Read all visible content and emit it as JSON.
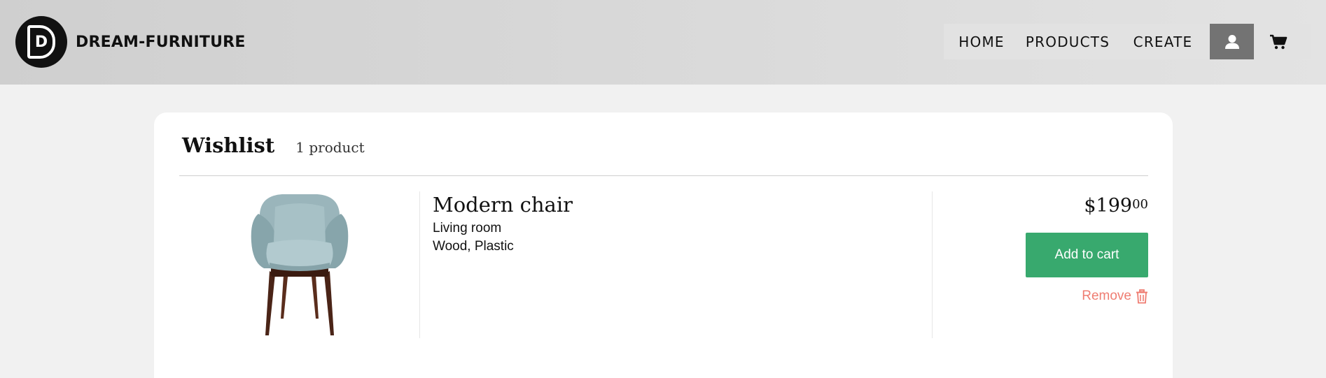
{
  "brand": {
    "logo_letter": "D",
    "name": "DREAM-FURNITURE"
  },
  "nav": {
    "items": [
      {
        "label": "HOME"
      },
      {
        "label": "PRODUCTS"
      },
      {
        "label": "CREATE"
      }
    ],
    "user_icon": "user-icon",
    "cart_icon": "cart-icon",
    "active_color": "#737373"
  },
  "wishlist": {
    "title": "Wishlist",
    "count": "1 product",
    "items": [
      {
        "name": "Modern chair",
        "category": "Living room",
        "materials": "Wood, Plastic",
        "price_main": "$199",
        "price_cents": "00",
        "add_label": "Add to cart",
        "remove_label": "Remove",
        "remove_icon": "trash-icon"
      }
    ]
  },
  "colors": {
    "accent_green": "#38a96e",
    "remove_red": "#ef7d72"
  }
}
